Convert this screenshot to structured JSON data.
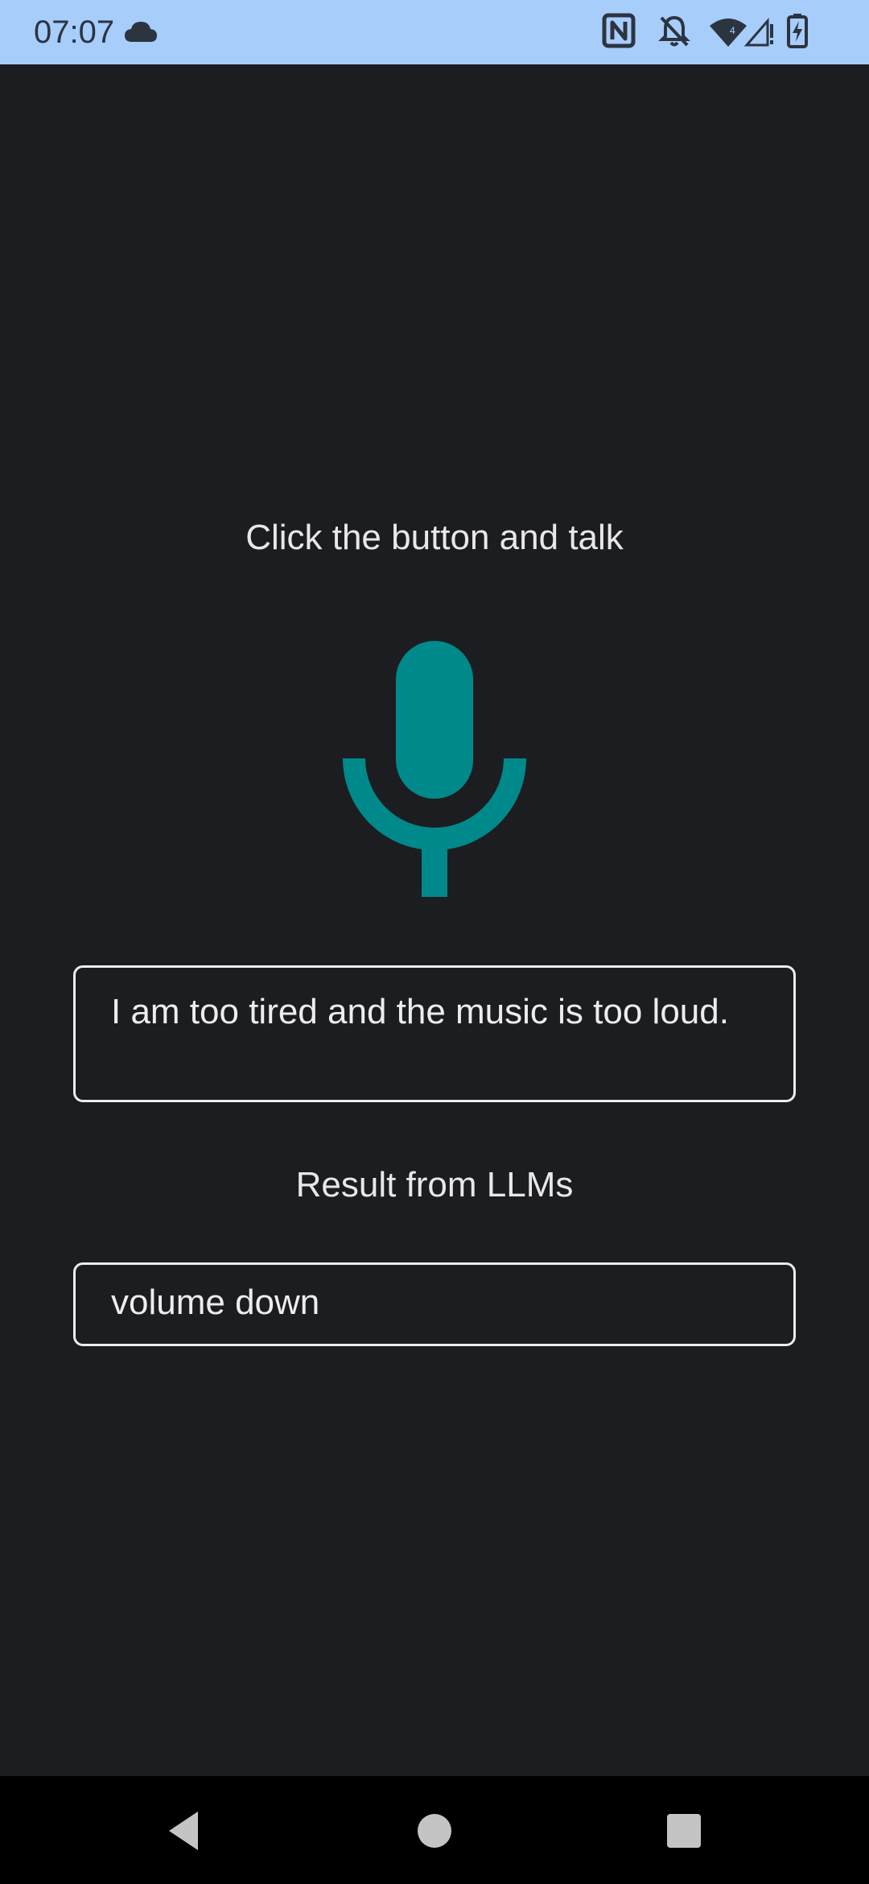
{
  "status_bar": {
    "time": "07:07",
    "background_color": "#a7cdfb",
    "icons": [
      "cloud-icon",
      "nfc-icon",
      "bell-off-icon",
      "wifi-icon",
      "signal-icon",
      "battery-charging-icon"
    ]
  },
  "main": {
    "prompt": "Click the button and talk",
    "mic_icon": "microphone-icon",
    "mic_color": "#00898a",
    "transcript": " I am too tired and the music is too loud.",
    "result_label": "Result from LLMs",
    "result_value": "volume down"
  },
  "nav_bar": {
    "buttons": [
      "back-icon",
      "home-icon",
      "recents-icon"
    ]
  }
}
